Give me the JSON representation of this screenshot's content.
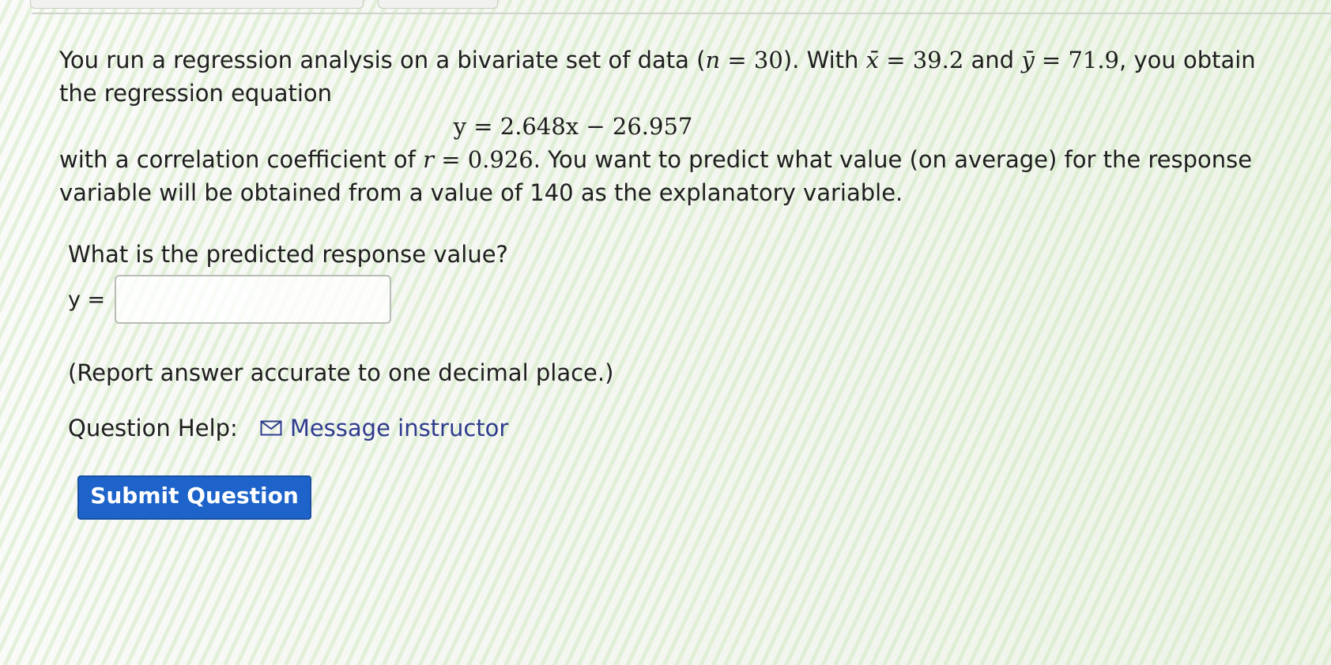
{
  "question": {
    "intro_1": "You run a regression analysis on a bivariate set of data (",
    "n_var": "n",
    "n_eq": " = 30",
    "intro_2": "). With ",
    "xbar": "x̄",
    "xbar_eq": " = 39.2",
    "and": " and ",
    "ybar": "ȳ",
    "ybar_eq": " = 71.9",
    "intro_3": ", you obtain the regression equation",
    "equation": "y = 2.648x − 26.957",
    "corr_1": "with a correlation coefficient of ",
    "r_var": "r",
    "r_eq": " = 0.926",
    "corr_2": ". You want to predict what value (on average) for the response variable will be obtained from a value of 140 as the explanatory variable."
  },
  "prompt": "What is the predicted response value?",
  "answer": {
    "label": "y =",
    "value": ""
  },
  "note": "(Report answer accurate to one decimal place.)",
  "help": {
    "label": "Question Help:",
    "icon": "envelope-icon",
    "link_text": "Message instructor"
  },
  "submit_label": "Submit Question",
  "colors": {
    "button_bg": "#1d63c9",
    "link": "#2f3b8e"
  }
}
